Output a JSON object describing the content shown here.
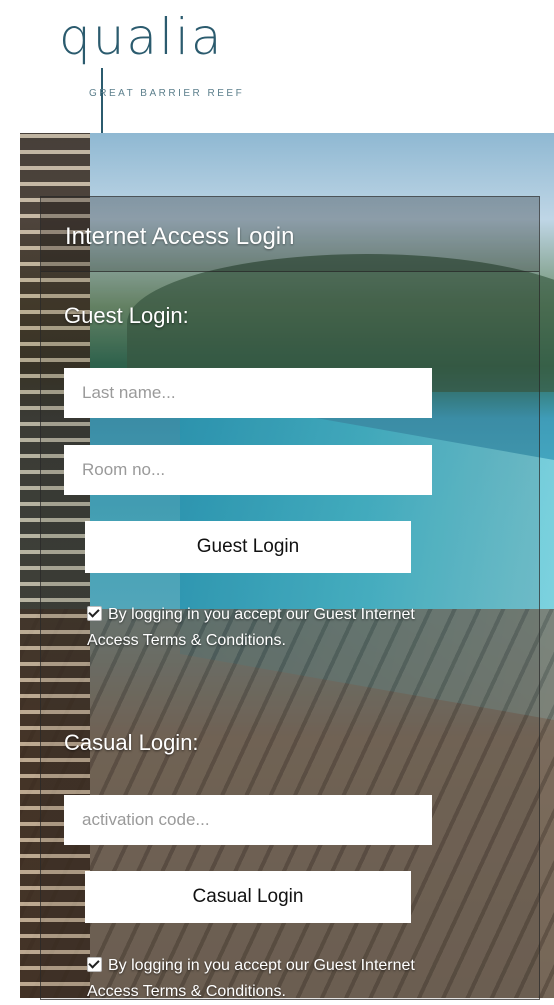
{
  "branding": {
    "logo_text": "qualia",
    "logo_subtitle": "GREAT BARRIER REEF"
  },
  "panel": {
    "title": "Internet Access Login"
  },
  "guest": {
    "section_label": "Guest Login:",
    "last_name_placeholder": "Last name...",
    "room_placeholder": "Room no...",
    "button_label": "Guest Login",
    "terms_text": "By logging in you accept our Guest Internet Access Terms & Conditions.",
    "terms_checked": true
  },
  "casual": {
    "section_label": "Casual Login:",
    "code_placeholder": "activation code...",
    "button_label": "Casual Login",
    "terms_text": "By logging in you accept our Guest Internet Access Terms & Conditions.",
    "terms_checked": true
  },
  "colors": {
    "logo": "#2b5b6e",
    "button_bg": "#ffffff",
    "panel_text": "#ffffff"
  }
}
